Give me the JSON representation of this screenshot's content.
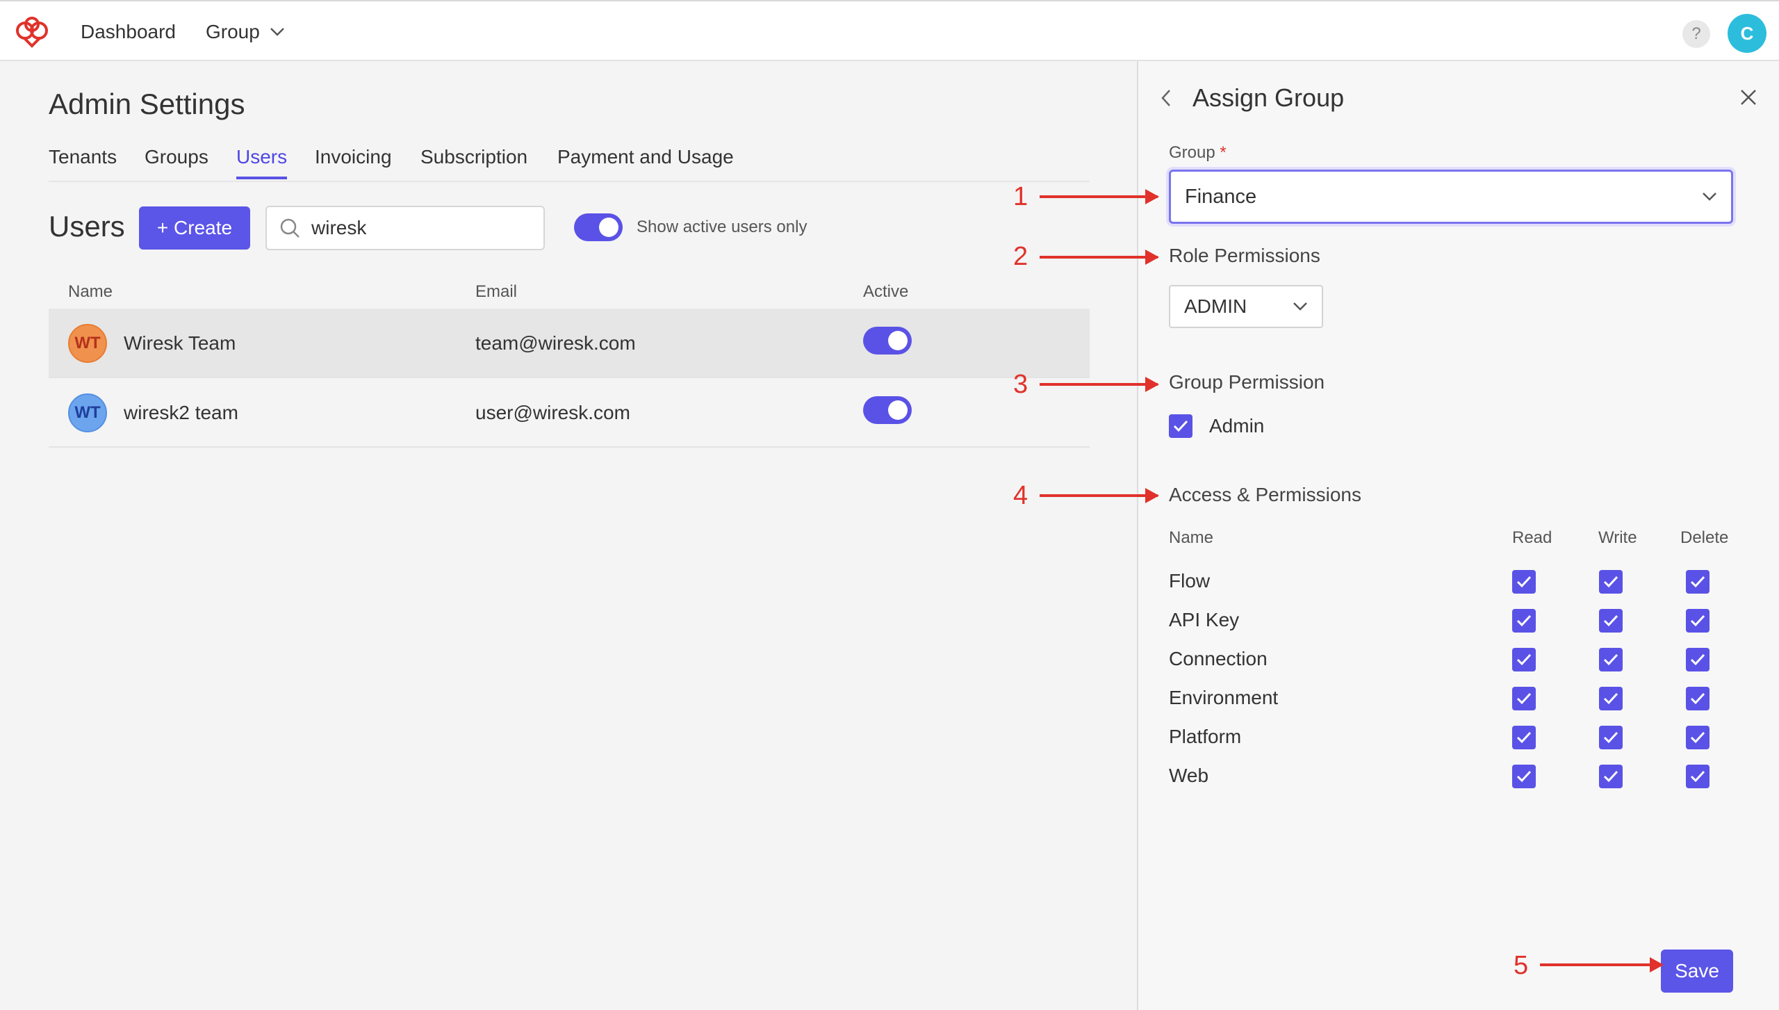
{
  "topbar": {
    "nav": [
      "Dashboard",
      "Group"
    ],
    "help_label": "?",
    "user_initial": "C"
  },
  "page": {
    "title": "Admin Settings",
    "tabs": [
      "Tenants",
      "Groups",
      "Users",
      "Invoicing",
      "Subscription",
      "Payment and Usage"
    ],
    "active_tab": "Users"
  },
  "users": {
    "heading": "Users",
    "create_label": "+ Create",
    "search_value": "wiresk",
    "active_filter_label": "Show active users only",
    "columns": [
      "Name",
      "Email",
      "Active"
    ],
    "rows": [
      {
        "initials": "WT",
        "name": "Wiresk Team",
        "email": "team@wiresk.com",
        "active": true,
        "avatar_bg": "#f0924d",
        "avatar_fg": "#b4321c"
      },
      {
        "initials": "WT",
        "name": "wiresk2 team",
        "email": "user@wiresk.com",
        "active": true,
        "avatar_bg": "#6ca5ee",
        "avatar_fg": "#1f3f9c"
      }
    ]
  },
  "panel": {
    "title": "Assign Group",
    "group_label": "Group",
    "required_mark": "*",
    "group_value": "Finance",
    "role_heading": "Role Permissions",
    "role_value": "ADMIN",
    "group_perm_heading": "Group Permission",
    "group_perm_option": "Admin",
    "access_heading": "Access & Permissions",
    "perm_columns": [
      "Name",
      "Read",
      "Write",
      "Delete"
    ],
    "perm_rows": [
      {
        "name": "Flow",
        "read": true,
        "write": true,
        "delete": true
      },
      {
        "name": "API Key",
        "read": true,
        "write": true,
        "delete": true
      },
      {
        "name": "Connection",
        "read": true,
        "write": true,
        "delete": true
      },
      {
        "name": "Environment",
        "read": true,
        "write": true,
        "delete": true
      },
      {
        "name": "Platform",
        "read": true,
        "write": true,
        "delete": true
      },
      {
        "name": "Web",
        "read": true,
        "write": true,
        "delete": true
      }
    ],
    "save_label": "Save"
  },
  "annotations": [
    "1",
    "2",
    "3",
    "4",
    "5"
  ],
  "colors": {
    "accent": "#5a52e6",
    "annotation": "#e0322b"
  }
}
